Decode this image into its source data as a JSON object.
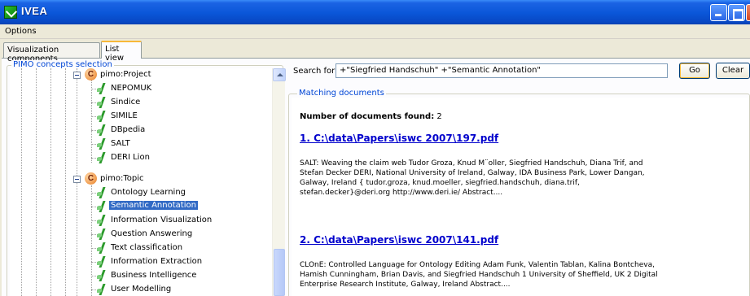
{
  "window": {
    "title": "IVEA"
  },
  "menu": {
    "options": "Options"
  },
  "tabs": [
    {
      "label": "Visualization components",
      "active": false
    },
    {
      "label": "List view",
      "active": true
    }
  ],
  "concepts": {
    "group_label": "PIMO concepts selection",
    "tree": [
      {
        "type": "class",
        "label": "pimo:Project",
        "expanded": true
      },
      {
        "type": "instance",
        "label": "NEPOMUK"
      },
      {
        "type": "instance",
        "label": "Sindice"
      },
      {
        "type": "instance",
        "label": "SIMILE"
      },
      {
        "type": "instance",
        "label": "DBpedia"
      },
      {
        "type": "instance",
        "label": "SALT"
      },
      {
        "type": "instance",
        "label": "DERI Lion"
      },
      {
        "type": "class",
        "label": "pimo:Topic",
        "expanded": true
      },
      {
        "type": "instance",
        "label": "Ontology Learning"
      },
      {
        "type": "instance",
        "label": "Semantic Annotation",
        "selected": true
      },
      {
        "type": "instance",
        "label": "Information Visualization"
      },
      {
        "type": "instance",
        "label": "Question Answering"
      },
      {
        "type": "instance",
        "label": "Text classification"
      },
      {
        "type": "instance",
        "label": "Information Extraction"
      },
      {
        "type": "instance",
        "label": "Business Intelligence"
      },
      {
        "type": "instance",
        "label": "User Modelling"
      }
    ],
    "class_icon": "C",
    "instance_icon": "instance-icon"
  },
  "search": {
    "label": "Search for",
    "value": "+\"Siegfried Handschuh\" +\"Semantic Annotation\"",
    "go_label": "Go",
    "clear_label": "Clear"
  },
  "results": {
    "group_label": "Matching documents",
    "count_label": "Number of documents found:",
    "count": "2",
    "documents": [
      {
        "link": "1. C:\\data\\Papers\\iswc 2007\\197.pdf",
        "abstract": "SALT: Weaving the claim web Tudor Groza, Knud M¨oller, Siegfried Handschuh, Diana Trif, and Stefan Decker DERI, National University of Ireland, Galway, IDA Business Park, Lower Dangan, Galway, Ireland { tudor.groza, knud.moeller, siegfried.handschuh, diana.trif, stefan.decker}@deri.org http://www.deri.ie/ Abstract...."
      },
      {
        "link": "2. C:\\data\\Papers\\iswc 2007\\141.pdf",
        "abstract": "CLOnE: Controlled Language for Ontology Editing Adam Funk, Valentin Tablan, Kalina Bontcheva, Hamish Cunningham, Brian Davis, and Siegfried Handschuh 1 University of Sheffield, UK 2 Digital Enterprise Research Institute, Galway, Ireland Abstract...."
      }
    ]
  },
  "colors": {
    "titlebar": "#0a56d8",
    "selection": "#316ac5",
    "link": "#0000cc",
    "group_label": "#0046d5"
  }
}
